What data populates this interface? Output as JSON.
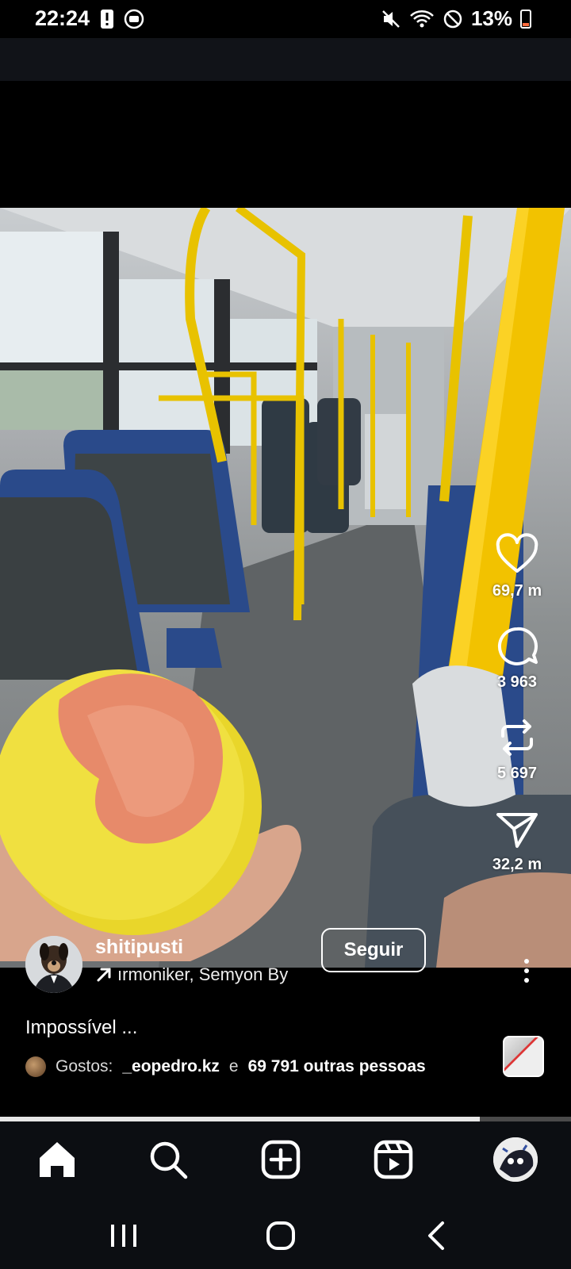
{
  "status_bar": {
    "time": "22:24",
    "battery": "13%",
    "left_icons": [
      "alert-icon",
      "screen-record-icon"
    ],
    "right_icons": [
      "mute-icon",
      "wifi-icon",
      "do-not-disturb-icon",
      "battery-icon"
    ]
  },
  "post": {
    "username": "shitipusti",
    "audio_label": "ırmoniker, Semyon By",
    "follow_label": "Seguir",
    "caption": "Impossível ...",
    "likes_prefix": "Gostos:",
    "likes_user": "_eopedro.kz",
    "likes_connector": "e",
    "likes_others": "69 791 outras pessoas"
  },
  "actions": {
    "likes": "69,7 m",
    "comments": "3 963",
    "reposts": "5 697",
    "shares": "32,2 m"
  },
  "progress": {
    "fraction": 0.84
  },
  "bottom_nav": [
    "home-icon",
    "search-icon",
    "create-icon",
    "reels-icon",
    "profile-avatar"
  ],
  "system_nav": [
    "recents-icon",
    "home-circle-icon",
    "back-icon"
  ],
  "colors": {
    "accent_yellow": "#f2c200",
    "background": "#000000"
  }
}
